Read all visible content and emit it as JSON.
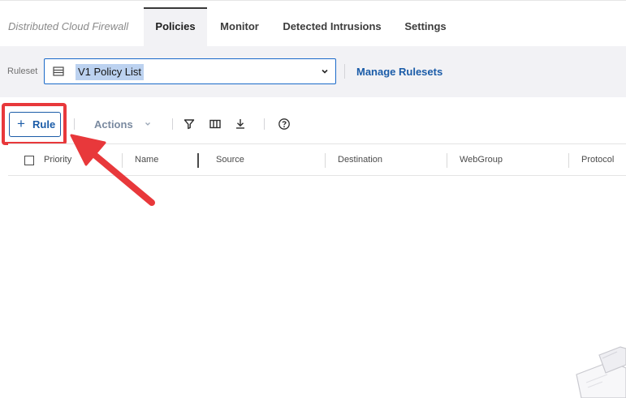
{
  "header": {
    "product_title": "Distributed Cloud Firewall",
    "tabs": [
      {
        "label": "Policies",
        "active": true
      },
      {
        "label": "Monitor",
        "active": false
      },
      {
        "label": "Detected Intrusions",
        "active": false
      },
      {
        "label": "Settings",
        "active": false
      }
    ]
  },
  "ruleset": {
    "label": "Ruleset",
    "selected": "V1 Policy List",
    "icon": "list-icon",
    "manage_link": "Manage Rulesets"
  },
  "toolbar": {
    "add_rule_plus": "+",
    "add_rule_label": "Rule",
    "actions_label": "Actions",
    "icons": [
      "filter-icon",
      "columns-icon",
      "download-icon",
      "help-icon"
    ]
  },
  "table": {
    "columns": [
      "Priority",
      "Name",
      "Source",
      "Destination",
      "WebGroup",
      "Protocol"
    ],
    "rows": []
  },
  "annotation": {
    "color": "#e8383b",
    "target": "add-rule-button"
  },
  "colors": {
    "accent": "#1b5ca8",
    "highlight": "#e8383b",
    "bar_background": "#f2f2f5"
  }
}
